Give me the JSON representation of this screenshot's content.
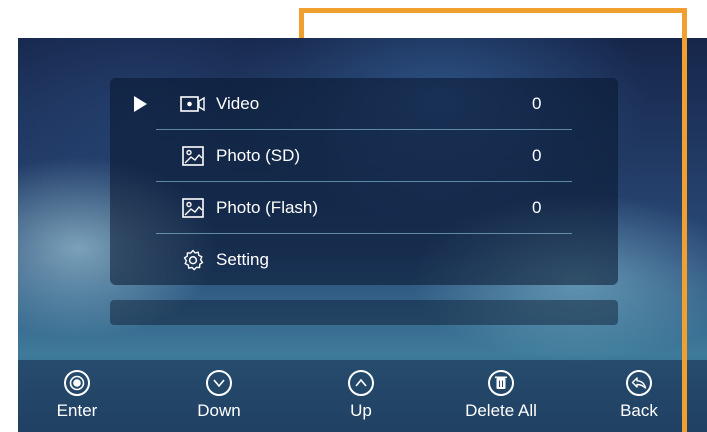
{
  "colors": {
    "highlight_frame": "#f0a030",
    "text": "#ffffff",
    "divider": "#8cc8e1"
  },
  "menu": {
    "items": [
      {
        "icon": "video-camera-icon",
        "label": "Video",
        "count": "0",
        "selected": true
      },
      {
        "icon": "photo-icon",
        "label": "Photo (SD)",
        "count": "0",
        "selected": false
      },
      {
        "icon": "photo-icon",
        "label": "Photo (Flash)",
        "count": "0",
        "selected": false
      },
      {
        "icon": "gear-icon",
        "label": "Setting",
        "count": "",
        "selected": false
      }
    ]
  },
  "bottom_bar": {
    "buttons": [
      {
        "icon": "enter-icon",
        "label": "Enter"
      },
      {
        "icon": "chevron-down-icon",
        "label": "Down"
      },
      {
        "icon": "chevron-up-icon",
        "label": "Up"
      },
      {
        "icon": "trash-icon",
        "label": "Delete All"
      },
      {
        "icon": "back-arrow-icon",
        "label": "Back"
      }
    ]
  }
}
